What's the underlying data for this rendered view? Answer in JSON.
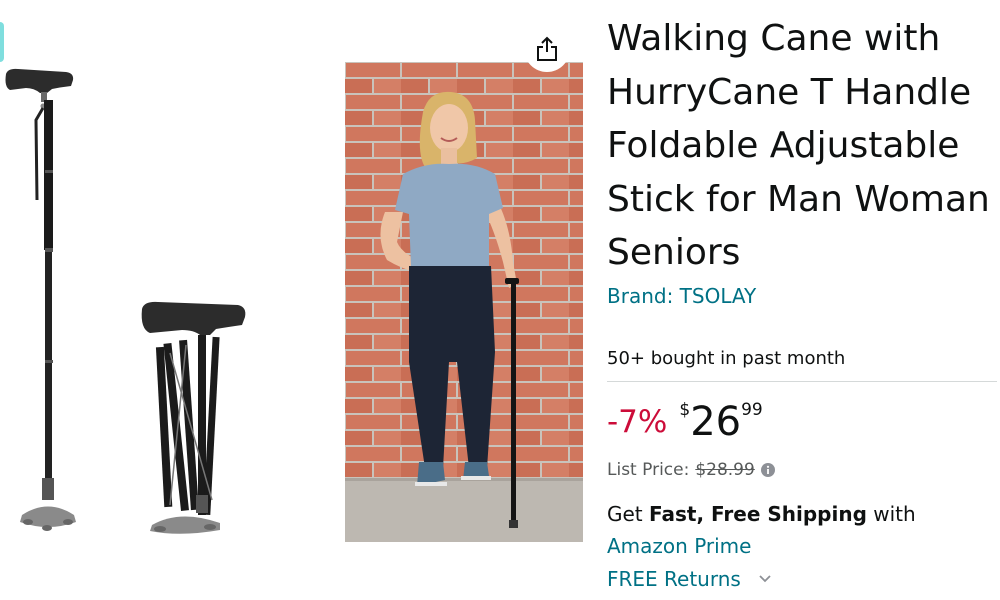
{
  "product": {
    "title": "Walking Cane with HurryCane T Handle Foldable Adjustable Stick for Man Woman Seniors",
    "brand_label": "Brand: TSOLAY",
    "bought": "50+ bought in past month"
  },
  "price": {
    "discount": "-7%",
    "currency": "$",
    "whole": "26",
    "fraction": "99",
    "list_label": "List Price:",
    "list_value": "$28.99"
  },
  "shipping": {
    "prefix": "Get ",
    "bold": "Fast, Free Shipping",
    "suffix": " with",
    "prime_link": "Amazon Prime",
    "returns_link": "FREE Returns"
  },
  "icons": {
    "share": "share-icon",
    "info": "info-icon",
    "chevron": "chevron-down-icon"
  },
  "colors": {
    "link": "#007185",
    "discount": "#cc0c39",
    "text": "#0f1111",
    "muted": "#565959"
  }
}
